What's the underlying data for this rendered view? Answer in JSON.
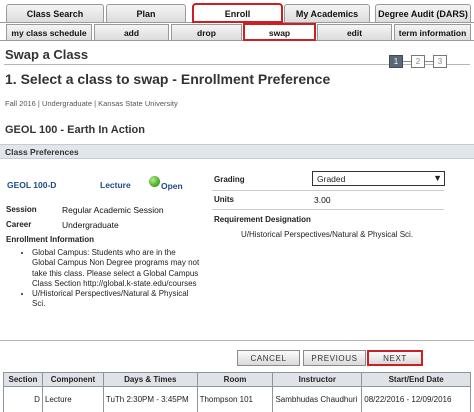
{
  "tabs": [
    "Class Search",
    "Plan",
    "Enroll",
    "My Academics",
    "Degree Audit (DARS)"
  ],
  "subtabs": [
    "my class schedule",
    "add",
    "drop",
    "swap",
    "edit",
    "term information"
  ],
  "page_title": "Swap a Class",
  "step_heading": "1.  Select a class to swap - Enrollment Preference",
  "stepper": [
    "1",
    "2",
    "3"
  ],
  "term_line": "Fall 2016 | Undergraduate | Kansas State University",
  "course_title": "GEOL  100 - Earth In Action",
  "section_header": "Class Preferences",
  "class": {
    "id": "GEOL  100-D",
    "component": "Lecture",
    "status": "Open"
  },
  "session_label": "Session",
  "session_value": "Regular Academic Session",
  "career_label": "Career",
  "career_value": "Undergraduate",
  "enroll_info_label": "Enrollment Information",
  "enroll_info": [
    "Global Campus: Students who are in the Global Campus Non Degree programs may not take this class. Please select a Global Campus Class Section http://global.k-state.edu/courses",
    "U/Historical Perspectives/Natural & Physical Sci."
  ],
  "grading_label": "Grading",
  "grading_value": "Graded",
  "units_label": "Units",
  "units_value": "3.00",
  "req_label": "Requirement Designation",
  "req_value": "U/Historical Perspectives/Natural & Physical Sci.",
  "buttons": {
    "cancel": "CANCEL",
    "previous": "PREVIOUS",
    "next": "NEXT"
  },
  "table": {
    "headers": [
      "Section",
      "Component",
      "Days & Times",
      "Room",
      "Instructor",
      "Start/End Date"
    ],
    "rows": [
      [
        "D",
        "Lecture",
        "TuTh 2:30PM - 3:45PM",
        "Thompson 101",
        "Sambhudas Chaudhuri",
        "08/22/2016 - 12/09/2016"
      ]
    ]
  }
}
